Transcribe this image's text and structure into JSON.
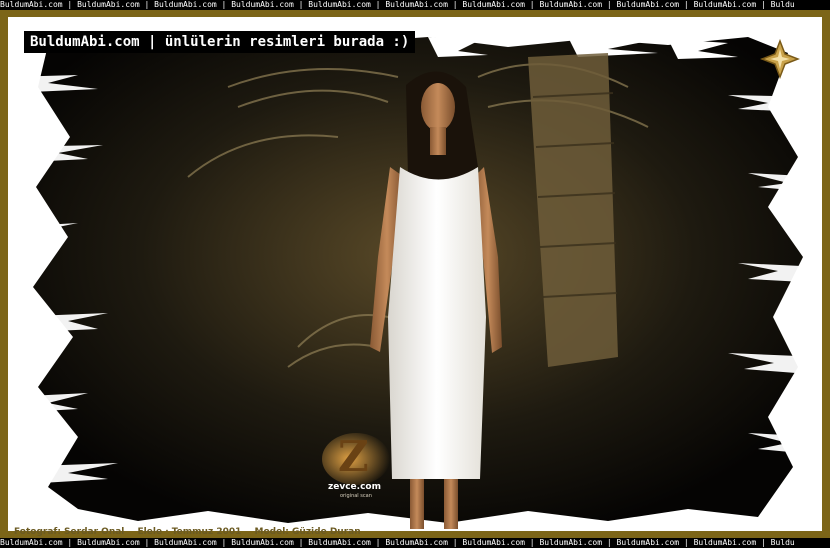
{
  "strip_text": "BuldumAbi.com | BuldumAbi.com | BuldumAbi.com | BuldumAbi.com | BuldumAbi.com | BuldumAbi.com | BuldumAbi.com | BuldumAbi.com | BuldumAbi.com | BuldumAbi.com | Buldu",
  "caption": "BuldumAbi.com | ünlülerin resimleri burada :)",
  "credit": {
    "photographer": "Fotograf: Serdar Onal",
    "issue": "Elele · Temmuz 2001",
    "model": "Model: Güzide Duran"
  },
  "watermark": {
    "letter": "Z",
    "site": "zevce.com",
    "sub": "original scan"
  },
  "colors": {
    "frame": "#7c6518",
    "strip_bg": "#000000",
    "dress": "#f4f2ee",
    "foliage": "#2a2414"
  },
  "icons": {
    "corner": "four-point-star-icon"
  }
}
